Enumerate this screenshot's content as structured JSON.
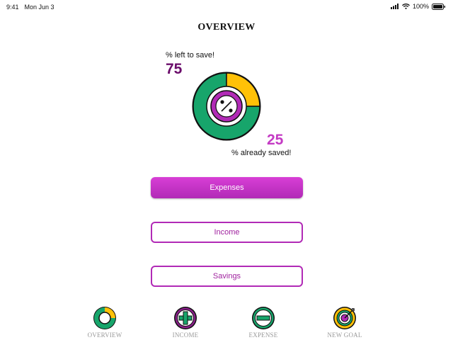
{
  "status_bar": {
    "time": "9:41",
    "date": "Mon Jun 3",
    "battery": "100%"
  },
  "page": {
    "title": "OVERVIEW"
  },
  "summary": {
    "left_label": "% left to save!",
    "left_value": "75",
    "right_value": "25",
    "right_label": "% already saved!"
  },
  "chart_data": {
    "type": "pie",
    "categories": [
      "% left to save!",
      "% already saved!"
    ],
    "values": [
      75,
      25
    ],
    "colors": {
      "left": "#17a56b",
      "saved": "#ffc107",
      "center": "#b12ab6"
    }
  },
  "buttons": {
    "expenses": "Expenses",
    "income": "Income",
    "savings": "Savings"
  },
  "tabs": [
    {
      "label": "OVERVIEW",
      "icon": "donut-chart-icon"
    },
    {
      "label": "INCOME",
      "icon": "plus-circle-icon"
    },
    {
      "label": "EXPENSE",
      "icon": "minus-circle-icon"
    },
    {
      "label": "NEW GOAL",
      "icon": "target-icon"
    }
  ]
}
